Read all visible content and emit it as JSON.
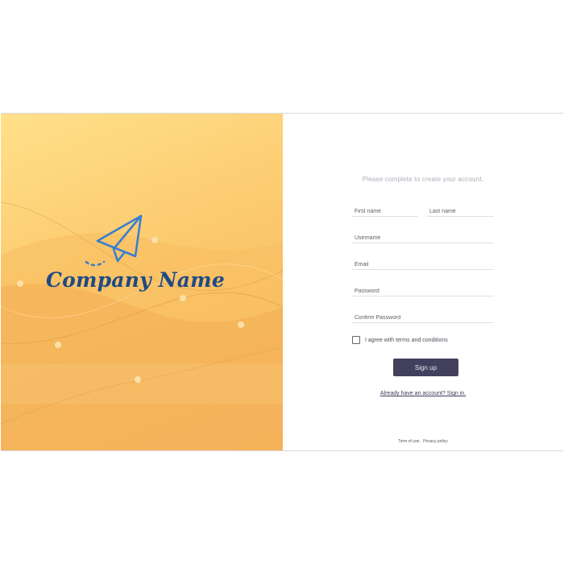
{
  "brand": {
    "company_name": "Company Name",
    "logo_icon": "paper-plane-icon",
    "logo_color": "#3a7fd0",
    "name_color": "#1f4a85",
    "panel_gradient": [
      "#ffe08a",
      "#fcc96d",
      "#f6b35b"
    ]
  },
  "form": {
    "intro": "Please complete to create your account.",
    "first_name_placeholder": "First name",
    "last_name_placeholder": "Last name",
    "username_placeholder": "Username",
    "email_placeholder": "Email",
    "password_placeholder": "Password",
    "confirm_password_placeholder": "Confirm Password",
    "terms_label": "I agree with terms and conditions",
    "terms_checked": false,
    "signup_label": "Sign up",
    "signup_color": "#42405d",
    "signin_link": "Already have an account? Sign in."
  },
  "footer": {
    "terms_of_use": "Term of use.",
    "privacy_policy": "Privacy policy"
  }
}
